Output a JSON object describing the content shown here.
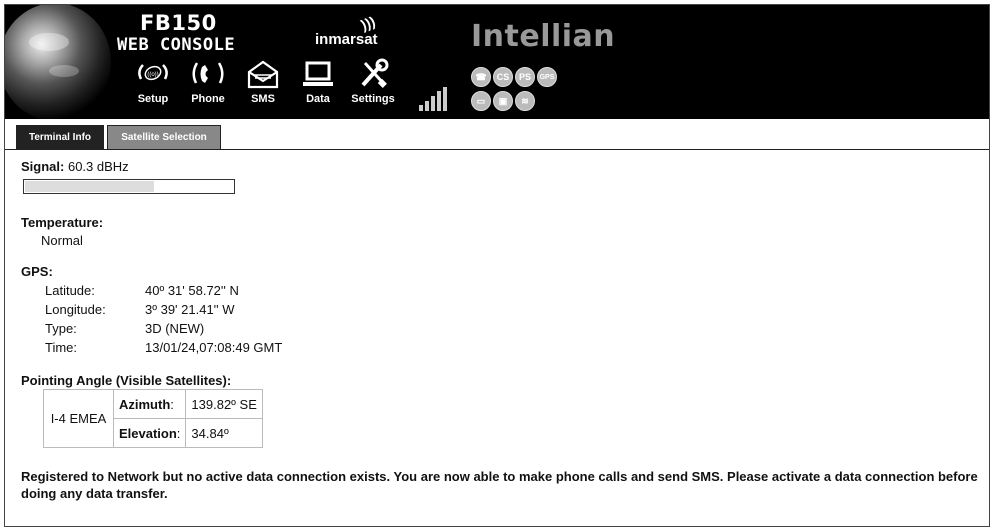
{
  "header": {
    "product_title": "FB150",
    "product_subtitle": "WEB CONSOLE",
    "inmarsat_logo": "inmarsat",
    "intellian_logo": "Intellian",
    "nav": [
      {
        "label": "Setup",
        "icon": "satellite-dish-icon"
      },
      {
        "label": "Phone",
        "icon": "phone-handset-icon"
      },
      {
        "label": "SMS",
        "icon": "envelope-icon"
      },
      {
        "label": "Data",
        "icon": "laptop-icon"
      },
      {
        "label": "Settings",
        "icon": "wrench-screwdriver-icon"
      }
    ],
    "signal_strength_icon": "signal-bars-icon",
    "status_icons": [
      "handset-status-icon",
      "cs-status-icon",
      "ps-status-icon",
      "gps-status-icon",
      "computer-status-icon",
      "lock-status-icon",
      "wifi-status-icon"
    ],
    "status_icon_labels": [
      "",
      "CS",
      "PS",
      "GPS",
      "",
      "",
      ""
    ]
  },
  "tabs": [
    {
      "label": "Terminal Info",
      "active": true
    },
    {
      "label": "Satellite Selection",
      "active": false
    }
  ],
  "signal": {
    "label": "Signal:",
    "value": "60.3 dBHz",
    "bar_fraction": 0.62
  },
  "temperature": {
    "label": "Temperature:",
    "value": "Normal"
  },
  "gps": {
    "label": "GPS:",
    "rows": [
      {
        "key": "Latitude:",
        "value": "40º 31' 58.72'' N"
      },
      {
        "key": "Longitude:",
        "value": "3º 39' 21.41'' W"
      },
      {
        "key": "Type:",
        "value": "3D (NEW)"
      },
      {
        "key": "Time:",
        "value": "13/01/24,07:08:49 GMT"
      }
    ]
  },
  "pointing": {
    "label": "Pointing Angle (Visible Satellites):",
    "satellite": "I-4 EMEA",
    "azimuth_label": "Azimuth",
    "azimuth_value": "139.82º SE",
    "elevation_label": "Elevation",
    "elevation_value": "34.84º"
  },
  "notice": "Registered to Network but no active data connection exists. You are now able to make phone calls and send SMS. Please activate a data connection before doing any data transfer.",
  "colors": {
    "header_bg": "#000000",
    "tab_active": "#222222",
    "tab_inactive": "#888888",
    "signal_fill": "#dddddd"
  }
}
